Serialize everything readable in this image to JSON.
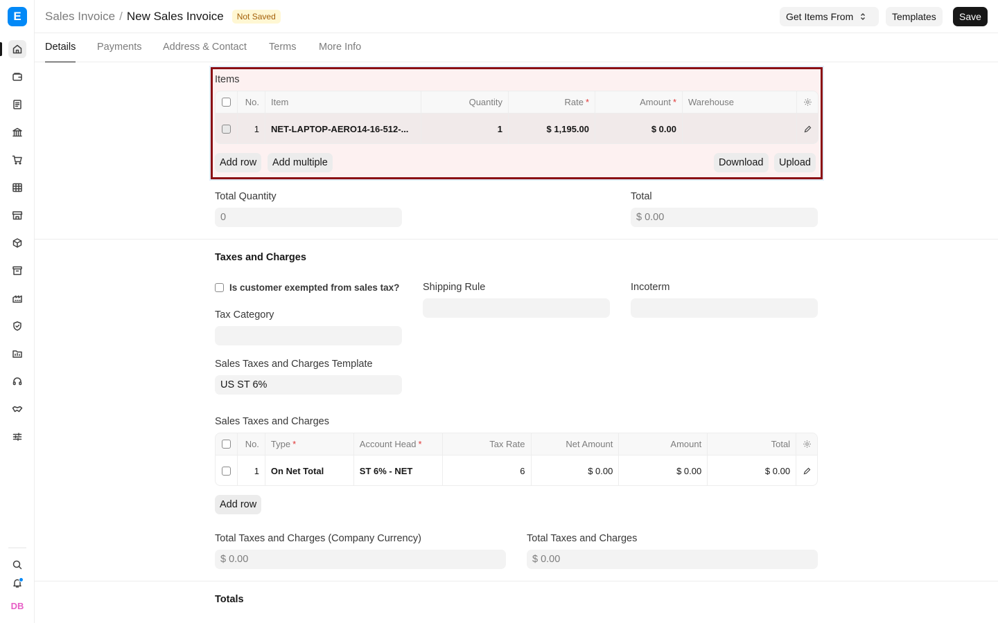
{
  "app": {
    "logo_letter": "E"
  },
  "sidebar": {
    "icons": [
      "home-icon",
      "wallet-icon",
      "document-icon",
      "bank-icon",
      "cart-icon",
      "table-icon",
      "store-icon",
      "package-icon",
      "archive-icon",
      "factory-icon",
      "shield-icon",
      "folder-icon",
      "headset-icon",
      "handshake-icon",
      "sliders-icon"
    ],
    "bottom_icons": [
      "search-icon",
      "bell-icon"
    ],
    "avatar_initials": "DB"
  },
  "header": {
    "breadcrumb_parent": "Sales Invoice",
    "breadcrumb_sep": "/",
    "title": "New Sales Invoice",
    "status_badge": "Not Saved",
    "get_items_label": "Get Items From",
    "templates_label": "Templates",
    "save_label": "Save"
  },
  "tabs": [
    "Details",
    "Payments",
    "Address & Contact",
    "Terms",
    "More Info"
  ],
  "items": {
    "label": "Items",
    "columns": {
      "no": "No.",
      "item": "Item",
      "quantity": "Quantity",
      "rate": "Rate",
      "amount": "Amount",
      "warehouse": "Warehouse"
    },
    "rows": [
      {
        "no": "1",
        "item": "NET-LAPTOP-AERO14-16-512-...",
        "quantity": "1",
        "rate": "$ 1,195.00",
        "amount": "$ 0.00",
        "warehouse": ""
      }
    ],
    "add_row_label": "Add row",
    "add_multiple_label": "Add multiple",
    "download_label": "Download",
    "upload_label": "Upload"
  },
  "totals_top": {
    "total_quantity_label": "Total Quantity",
    "total_quantity_value": "0",
    "total_label": "Total",
    "total_value": "$ 0.00"
  },
  "taxes": {
    "section_title": "Taxes and Charges",
    "exempt_label": "Is customer exempted from sales tax?",
    "shipping_rule_label": "Shipping Rule",
    "shipping_rule_value": "",
    "incoterm_label": "Incoterm",
    "incoterm_value": "",
    "tax_category_label": "Tax Category",
    "tax_category_value": "",
    "template_label": "Sales Taxes and Charges Template",
    "template_value": "US ST 6%",
    "table_label": "Sales Taxes and Charges",
    "columns": {
      "no": "No.",
      "type": "Type",
      "account_head": "Account Head",
      "tax_rate": "Tax Rate",
      "net_amount": "Net Amount",
      "amount": "Amount",
      "total": "Total"
    },
    "rows": [
      {
        "no": "1",
        "type": "On Net Total",
        "account_head": "ST 6% - NET",
        "tax_rate": "6",
        "net_amount": "$ 0.00",
        "amount": "$ 0.00",
        "total": "$ 0.00"
      }
    ],
    "add_row_label": "Add row",
    "total_company_label": "Total Taxes and Charges (Company Currency)",
    "total_company_value": "$ 0.00",
    "total_label": "Total Taxes and Charges",
    "total_value": "$ 0.00"
  },
  "totals_section_title": "Totals"
}
